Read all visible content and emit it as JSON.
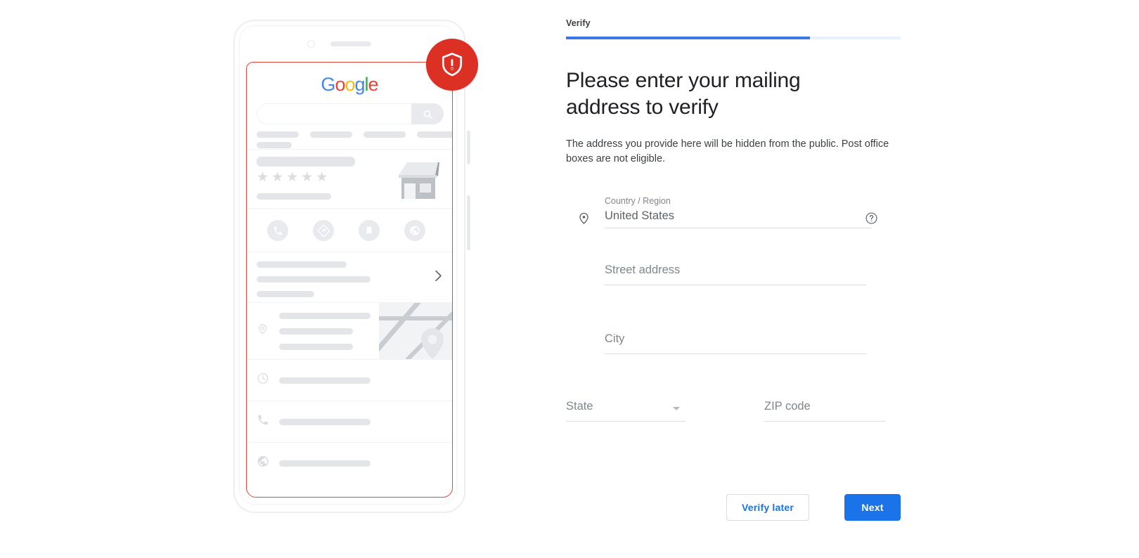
{
  "progress": {
    "step_label": "Verify",
    "percent": 73,
    "fill_color": "#3b78e7",
    "track_color": "#e8f0fe"
  },
  "headline": "Please enter your mailing address to verify",
  "subtext": "The address you provide here will be hidden from the public. Post office boxes are not eligible.",
  "form": {
    "country": {
      "label": "Country / Region",
      "value": "United States",
      "leading_icon": "location-pin-icon",
      "trailing_icon": "help-circle-icon"
    },
    "street": {
      "placeholder": "Street address",
      "value": ""
    },
    "city": {
      "placeholder": "City",
      "value": ""
    },
    "state": {
      "placeholder": "State",
      "value": "",
      "trailing_icon": "caret-down-icon"
    },
    "zip": {
      "placeholder": "ZIP code",
      "value": ""
    }
  },
  "buttons": {
    "secondary_label": "Verify later",
    "primary_label": "Next",
    "primary_color": "#1a73e8",
    "secondary_text_color": "#1a73e8"
  },
  "illustration": {
    "name": "phone-mockup-google-business-listing",
    "badge": {
      "icon": "shield-alert-icon",
      "color": "#dc3025"
    },
    "screen_highlight_color": "#ea4335",
    "logo": {
      "name": "google-logo",
      "letters": [
        {
          "char": "G",
          "color": "#4285F4"
        },
        {
          "char": "o",
          "color": "#EA4335"
        },
        {
          "char": "o",
          "color": "#FBBC05"
        },
        {
          "char": "g",
          "color": "#4285F4"
        },
        {
          "char": "l",
          "color": "#34A853"
        },
        {
          "char": "e",
          "color": "#EA4335"
        }
      ]
    },
    "search_icon": "magnifier-icon",
    "rating_stars": 5,
    "action_icons": [
      "phone-icon",
      "directions-icon",
      "bookmark-icon",
      "website-globe-icon"
    ],
    "list_icons": [
      "clock-icon",
      "phone-handset-icon",
      "globe-icon"
    ],
    "chevron_icon": "chevron-right-icon",
    "map_pin_icon": "map-pin-icon",
    "address_pin_icon": "location-pin-outline-icon",
    "storefront_icon": "storefront-icon"
  }
}
